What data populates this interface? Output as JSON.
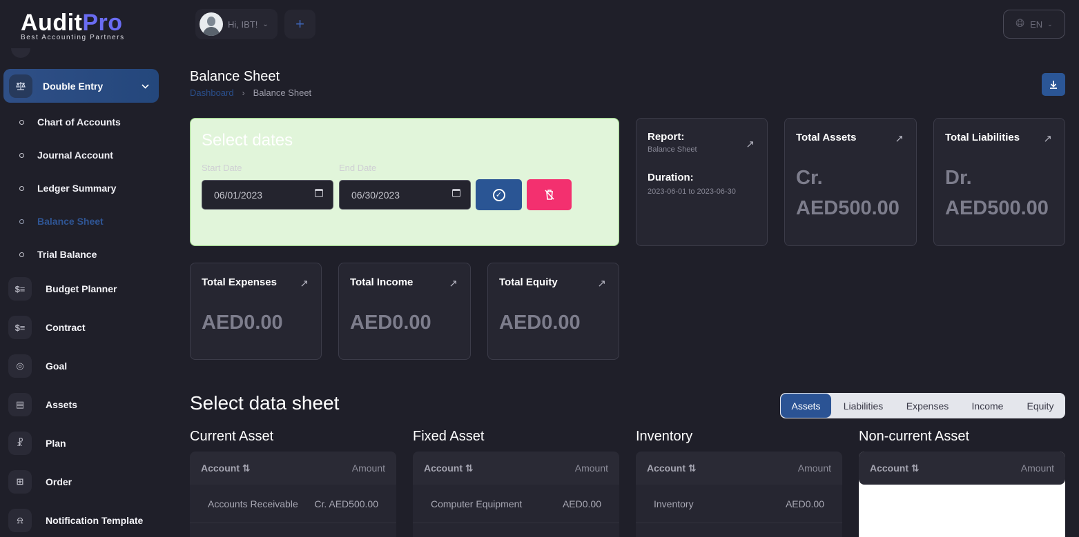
{
  "app": {
    "logo_main_a": "Audit",
    "logo_main_b": "Pro",
    "logo_sub": "Best Accounting Partners"
  },
  "sidebar": {
    "active_group": {
      "label": "Double Entry",
      "icon": "scale-icon"
    },
    "sub_items": [
      {
        "label": "Chart of Accounts"
      },
      {
        "label": "Journal Account"
      },
      {
        "label": "Ledger Summary"
      },
      {
        "label": "Balance Sheet",
        "current": true
      },
      {
        "label": "Trial Balance"
      }
    ],
    "items": [
      {
        "label": "Budget Planner",
        "icon": "money-stack-icon"
      },
      {
        "label": "Contract",
        "icon": "money-stack-icon"
      },
      {
        "label": "Goal",
        "icon": "target-icon"
      },
      {
        "label": "Assets",
        "icon": "calculator-icon"
      },
      {
        "label": "Plan",
        "icon": "trophy-icon"
      },
      {
        "label": "Order",
        "icon": "cart-icon"
      },
      {
        "label": "Notification Template",
        "icon": "bell-icon"
      }
    ]
  },
  "topbar": {
    "greeting": "Hi, IBT!",
    "language": "EN"
  },
  "header": {
    "title": "Balance Sheet",
    "breadcrumb_home": "Dashboard",
    "breadcrumb_current": "Balance Sheet"
  },
  "dates": {
    "title": "Select dates",
    "start_label": "Start Date",
    "end_label": "End Date",
    "start_value": "06/01/2023",
    "end_value": "06/30/2023"
  },
  "report_card": {
    "report_label": "Report:",
    "report_value": "Balance Sheet",
    "duration_label": "Duration:",
    "duration_value": "2023-06-01 to 2023-06-30"
  },
  "stats": {
    "total_assets": {
      "title": "Total Assets",
      "prefix": "Cr.",
      "value": "AED500.00"
    },
    "total_liabilities": {
      "title": "Total Liabilities",
      "prefix": "Dr.",
      "value": "AED500.00"
    },
    "total_expenses": {
      "title": "Total Expenses",
      "value": "AED0.00"
    },
    "total_income": {
      "title": "Total Income",
      "value": "AED0.00"
    },
    "total_equity": {
      "title": "Total Equity",
      "value": "AED0.00"
    }
  },
  "datasheet": {
    "title": "Select data sheet",
    "tabs": [
      "Assets",
      "Liabilities",
      "Expenses",
      "Income",
      "Equity"
    ],
    "active_tab": "Assets",
    "col_account": "Account",
    "col_amount": "Amount",
    "sections": [
      {
        "title": "Current Asset",
        "rows": [
          {
            "account": "Accounts Receivable",
            "amount": "Cr. AED500.00"
          }
        ]
      },
      {
        "title": "Fixed Asset",
        "rows": [
          {
            "account": "Computer Equipment",
            "amount": "AED0.00"
          }
        ]
      },
      {
        "title": "Inventory",
        "rows": [
          {
            "account": "Inventory",
            "amount": "AED0.00"
          }
        ]
      },
      {
        "title": "Non-current Asset",
        "rows": []
      }
    ]
  }
}
